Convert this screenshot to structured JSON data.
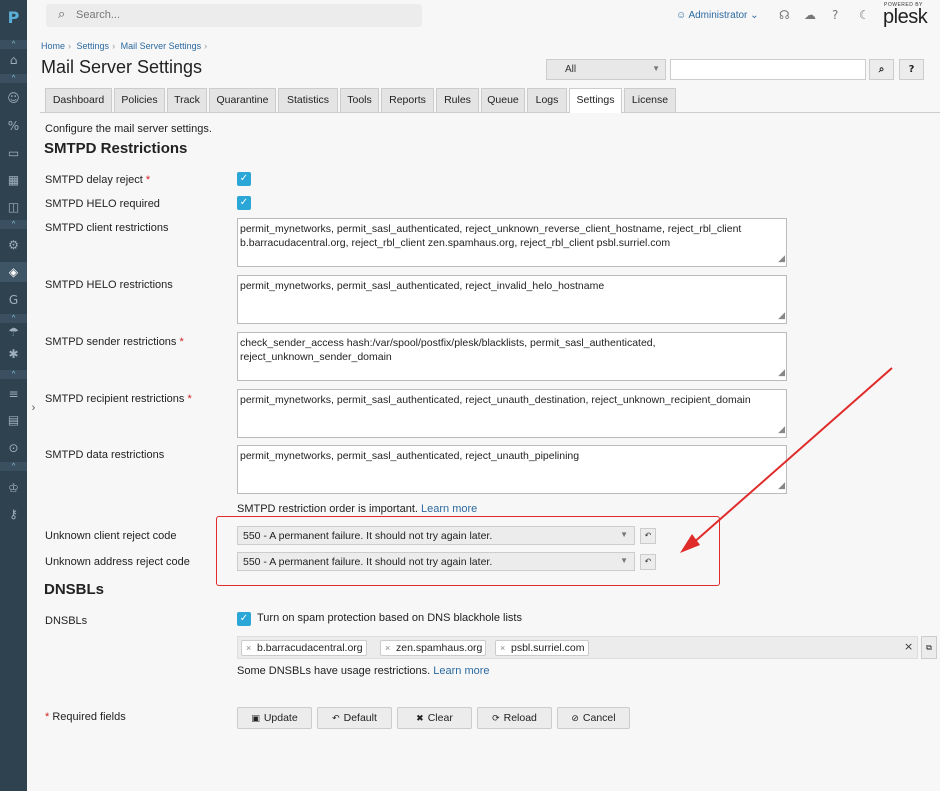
{
  "sidebar": {
    "logo": "P",
    "icons": [
      "home-icon",
      "user-icon",
      "percent-icon",
      "monitor-icon",
      "apps-icon",
      "book-icon",
      "shield-gear-icon",
      "security-icon",
      "g-icon",
      "gear-icon",
      "sliders-icon",
      "grid-icon",
      "search-icon",
      "crown-icon",
      "key-icon"
    ]
  },
  "header": {
    "search_placeholder": "Search...",
    "user": "Administrator",
    "powered_by": "POWERED BY",
    "logo_text": "plesk"
  },
  "breadcrumb": [
    "Home",
    "Settings",
    "Mail Server Settings"
  ],
  "page_title": "Mail Server Settings",
  "filter": {
    "selected": "All",
    "search_value": "",
    "search_btn": "⌕",
    "help_btn": "?"
  },
  "tabs": [
    "Dashboard",
    "Policies",
    "Track",
    "Quarantine",
    "Statistics",
    "Tools",
    "Reports",
    "Rules",
    "Queue",
    "Logs",
    "Settings",
    "License"
  ],
  "active_tab": "Settings",
  "description": "Configure the mail server settings.",
  "smtpd": {
    "title": "SMTPD Restrictions",
    "delay_reject_label": "SMTPD delay reject",
    "helo_required_label": "SMTPD HELO required",
    "client_label": "SMTPD client restrictions",
    "client_value": "permit_mynetworks, permit_sasl_authenticated, reject_unknown_reverse_client_hostname, reject_rbl_client b.barracudacentral.org, reject_rbl_client zen.spamhaus.org, reject_rbl_client psbl.surriel.com",
    "helo_label": "SMTPD HELO restrictions",
    "helo_value": "permit_mynetworks, permit_sasl_authenticated, reject_invalid_helo_hostname",
    "sender_label": "SMTPD sender restrictions",
    "sender_value": "check_sender_access hash:/var/spool/postfix/plesk/blacklists, permit_sasl_authenticated, reject_unknown_sender_domain",
    "recipient_label": "SMTPD recipient restrictions",
    "recipient_value": "permit_mynetworks, permit_sasl_authenticated, reject_unauth_destination, reject_unknown_recipient_domain",
    "data_label": "SMTPD data restrictions",
    "data_value": "permit_mynetworks, permit_sasl_authenticated, reject_unauth_pipelining",
    "order_note": "SMTPD restriction order is important.",
    "learn_more": "Learn more",
    "unknown_client_label": "Unknown client reject code",
    "unknown_client_value": "550 - A permanent failure. It should not try again later.",
    "unknown_address_label": "Unknown address reject code",
    "unknown_address_value": "550 - A permanent failure. It should not try again later."
  },
  "dnsbl": {
    "title": "DNSBLs",
    "label": "DNSBLs",
    "checkbox_label": "Turn on spam protection based on DNS blackhole lists",
    "tags": [
      "b.barracudacentral.org",
      "zen.spamhaus.org",
      "psbl.surriel.com"
    ],
    "note": "Some DNSBLs have usage restrictions.",
    "learn_more": "Learn more"
  },
  "footer": {
    "required_note": "* Required fields",
    "buttons": [
      "Update",
      "Default",
      "Clear",
      "Reload",
      "Cancel"
    ]
  },
  "colors": {
    "sidebar": "#2f4250",
    "accent": "#2aa7d6",
    "link": "#2c6aa0",
    "annotation": "#e02b2b"
  }
}
